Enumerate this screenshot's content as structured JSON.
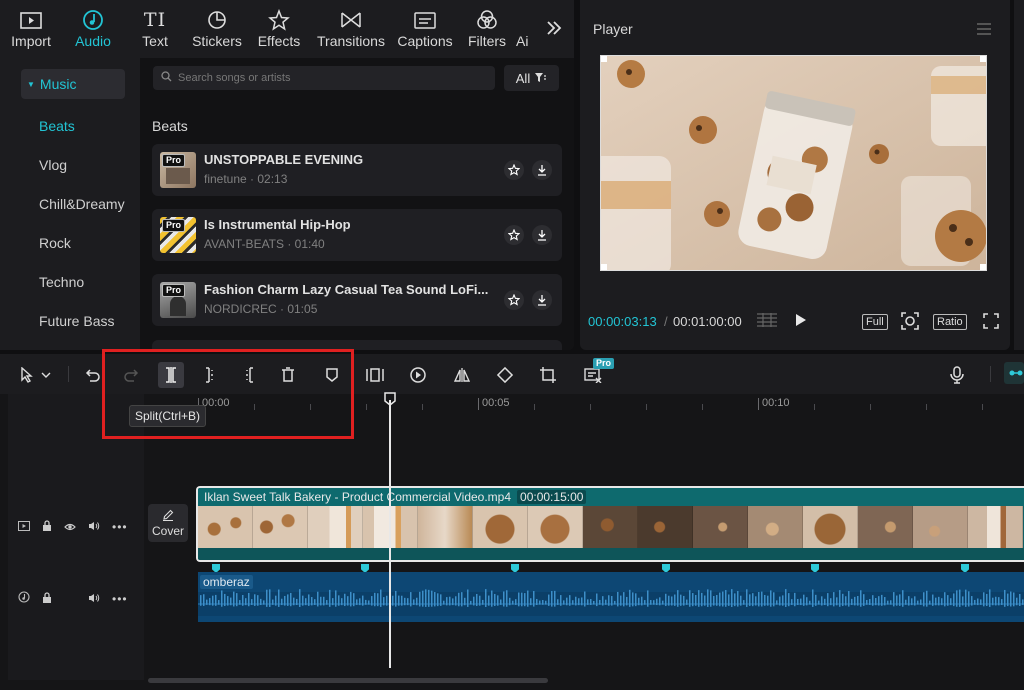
{
  "tabs": [
    {
      "label": "Import",
      "icon": "import-icon"
    },
    {
      "label": "Audio",
      "icon": "audio-icon",
      "active": true
    },
    {
      "label": "Text",
      "icon": "text-icon"
    },
    {
      "label": "Stickers",
      "icon": "stickers-icon"
    },
    {
      "label": "Effects",
      "icon": "effects-icon"
    },
    {
      "label": "Transitions",
      "icon": "transitions-icon"
    },
    {
      "label": "Captions",
      "icon": "captions-icon"
    },
    {
      "label": "Filters",
      "icon": "filters-icon"
    },
    {
      "label": "Ai",
      "icon": "ai-icon"
    }
  ],
  "sidebar": {
    "group": "Music",
    "items": [
      "Beats",
      "Vlog",
      "Chill&Dreamy",
      "Rock",
      "Techno",
      "Future Bass"
    ],
    "selected": "Beats"
  },
  "search": {
    "placeholder": "Search songs or artists",
    "filter_label": "All"
  },
  "section": "Beats",
  "songs": [
    {
      "title": "UNSTOPPABLE EVENING",
      "meta": "finetune · 02:13",
      "badge": "Pro"
    },
    {
      "title": "Is Instrumental Hip-Hop",
      "meta": "AVANT-BEATS · 01:40",
      "badge": "Pro"
    },
    {
      "title": "Fashion Charm Lazy Casual Tea Sound LoFi...",
      "meta": "NORDICREC · 01:05",
      "badge": "Pro"
    }
  ],
  "player": {
    "title": "Player",
    "current_time": "00:00:03:13",
    "separator": "/",
    "duration": "00:01:00:00",
    "full_label": "Full",
    "ratio_label": "Ratio"
  },
  "toolbar": {
    "pro_badge": "Pro",
    "tooltip": "Split(Ctrl+B)"
  },
  "ruler": {
    "labels": [
      "00:00",
      "00:05",
      "00:10"
    ]
  },
  "video_clip": {
    "name": "Iklan Sweet Talk Bakery - Product Commercial Video.mp4",
    "duration": "00:00:15:00"
  },
  "cover_label": "Cover",
  "audio_clip": {
    "name": "omberaz"
  },
  "colors": {
    "accent": "#22c4d4",
    "highlight": "#e02020",
    "video_track": "#0f5e63",
    "audio_track": "#0d4774"
  }
}
